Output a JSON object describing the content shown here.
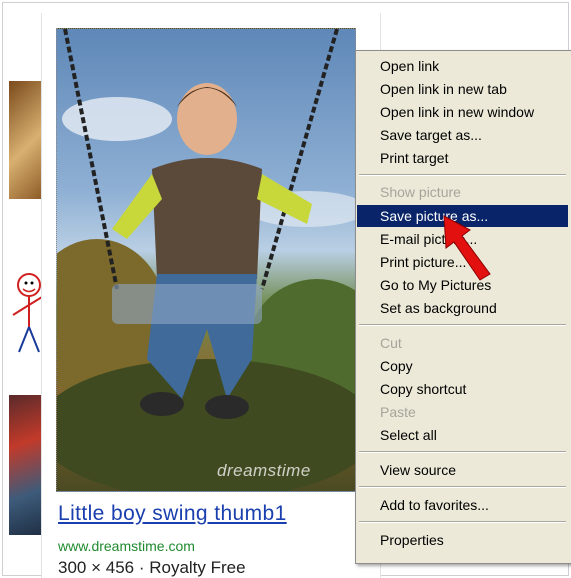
{
  "page": {
    "watermark": "dreamstime",
    "result_title": "Little boy swing thumb1",
    "result_url": "www.dreamstime.com",
    "result_meta": "300 × 456 · Royalty Free"
  },
  "context_menu": {
    "items": [
      {
        "label": "Open link"
      },
      {
        "label": "Open link in new tab"
      },
      {
        "label": "Open link in new window"
      },
      {
        "label": "Save target as..."
      },
      {
        "label": "Print target"
      },
      {
        "label": "Show picture"
      },
      {
        "label": "Save picture as..."
      },
      {
        "label": "E-mail picture..."
      },
      {
        "label": "Print picture..."
      },
      {
        "label": "Go to My Pictures"
      },
      {
        "label": "Set as background"
      },
      {
        "label": "Cut"
      },
      {
        "label": "Copy"
      },
      {
        "label": "Copy shortcut"
      },
      {
        "label": "Paste"
      },
      {
        "label": "Select all"
      },
      {
        "label": "View source"
      },
      {
        "label": "Add to favorites..."
      },
      {
        "label": "Properties"
      }
    ],
    "selected_item": "Save picture as...",
    "disabled_items": [
      "Show picture",
      "Cut",
      "Paste"
    ]
  },
  "colors": {
    "menu_background": "#ece9d8",
    "selection_background": "#0a246a",
    "disabled_text": "#a7a59b",
    "pointer_arrow": "#e31010"
  },
  "icons": [
    "pointer-arrow-icon"
  ]
}
